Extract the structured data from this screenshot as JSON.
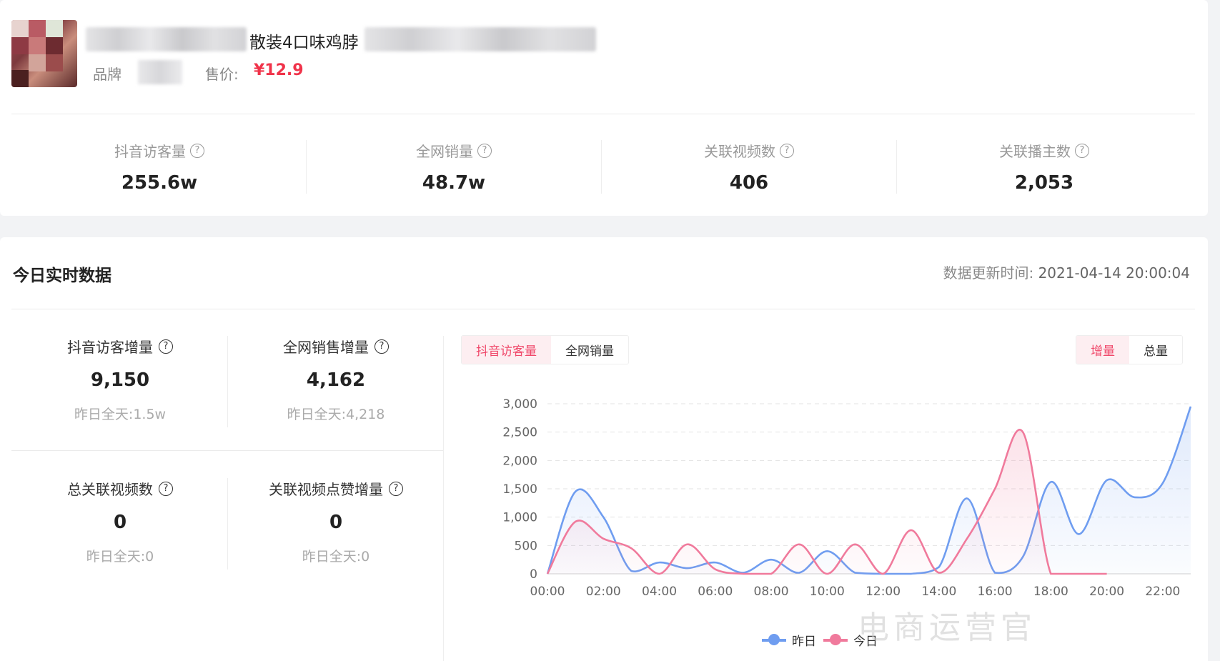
{
  "product": {
    "title": "散装4口味鸡脖",
    "brand_label": "品牌",
    "price_label": "售价:",
    "price": "¥12.9"
  },
  "stats": [
    {
      "label": "抖音访客量",
      "value": "255.6w"
    },
    {
      "label": "全网销量",
      "value": "48.7w"
    },
    {
      "label": "关联视频数",
      "value": "406"
    },
    {
      "label": "关联播主数",
      "value": "2,053"
    }
  ],
  "realtime": {
    "title": "今日实时数据",
    "update_label": "数据更新时间:",
    "update_time": "2021-04-14 20:00:04",
    "metrics": [
      {
        "label": "抖音访客增量",
        "value": "9,150",
        "sub_label": "昨日全天:",
        "sub_value": "1.5w"
      },
      {
        "label": "全网销售增量",
        "value": "4,162",
        "sub_label": "昨日全天:",
        "sub_value": "4,218"
      },
      {
        "label": "总关联视频数",
        "value": "0",
        "sub_label": "昨日全天:",
        "sub_value": "0"
      },
      {
        "label": "关联视频点赞增量",
        "value": "0",
        "sub_label": "昨日全天:",
        "sub_value": "0"
      }
    ],
    "tabs_left": [
      "抖音访客量",
      "全网销量"
    ],
    "tabs_right": [
      "增量",
      "总量"
    ]
  },
  "watermark": "电商运营官",
  "colors": {
    "accent": "#f0486a",
    "price": "#f0334a",
    "series_blue": "#6f9df0",
    "series_pink": "#f07a9c"
  },
  "chart_data": {
    "type": "area",
    "x": [
      "00:00",
      "01:00",
      "02:00",
      "03:00",
      "04:00",
      "05:00",
      "06:00",
      "07:00",
      "08:00",
      "09:00",
      "10:00",
      "11:00",
      "12:00",
      "13:00",
      "14:00",
      "15:00",
      "16:00",
      "17:00",
      "18:00",
      "19:00",
      "20:00",
      "21:00",
      "22:00",
      "23:00"
    ],
    "xticks": [
      "00:00",
      "02:00",
      "04:00",
      "06:00",
      "08:00",
      "10:00",
      "12:00",
      "14:00",
      "16:00",
      "18:00",
      "20:00",
      "22:00"
    ],
    "yticks": [
      "0",
      "500",
      "1,000",
      "1,500",
      "2,000",
      "2,500",
      "3,000"
    ],
    "ylim": [
      0,
      3000
    ],
    "grid": true,
    "legend_position": "bottom",
    "series": [
      {
        "name": "昨日",
        "color": "#6f9df0",
        "values": [
          0,
          1450,
          1000,
          50,
          200,
          100,
          200,
          20,
          250,
          20,
          400,
          20,
          0,
          0,
          120,
          1330,
          20,
          300,
          1620,
          700,
          1650,
          1350,
          1600,
          2950
        ]
      },
      {
        "name": "今日",
        "color": "#f07a9c",
        "values": [
          0,
          920,
          620,
          450,
          0,
          520,
          80,
          0,
          0,
          520,
          0,
          520,
          0,
          770,
          20,
          620,
          1500,
          2500,
          0,
          0,
          0,
          null,
          null,
          null
        ]
      }
    ]
  }
}
